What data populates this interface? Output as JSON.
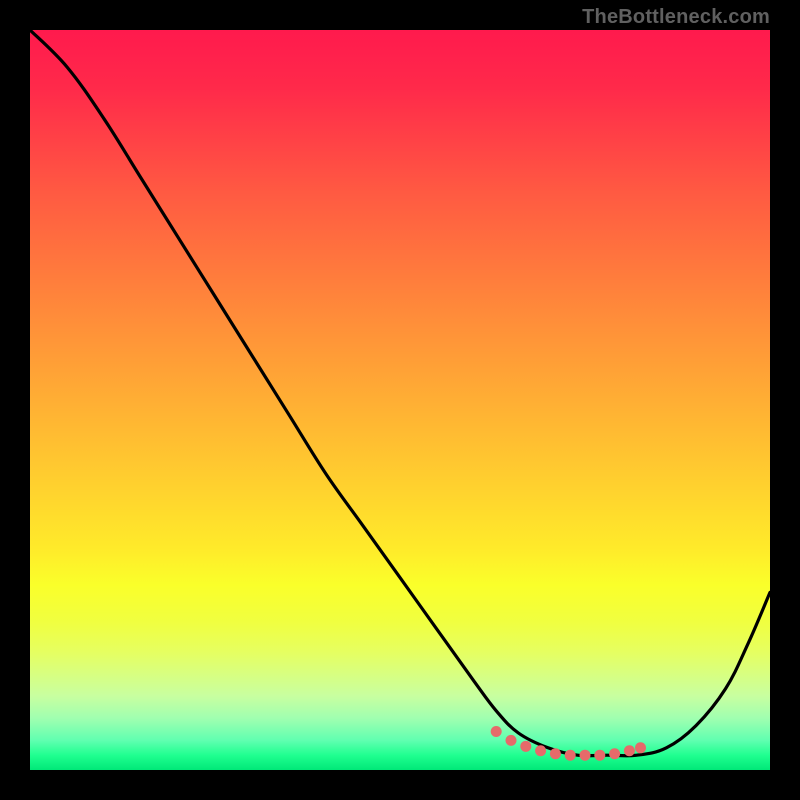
{
  "attribution": "TheBottleneck.com",
  "colors": {
    "background": "#000000",
    "gradient_top": "#ff1a4d",
    "gradient_bottom": "#00e878",
    "curve": "#000000",
    "markers": "#e66a6a"
  },
  "chart_data": {
    "type": "line",
    "title": "",
    "xlabel": "",
    "ylabel": "",
    "xlim": [
      0,
      100
    ],
    "ylim": [
      0,
      100
    ],
    "note": "X as percent across plot width, Y as percent bottleneck (0 = bottom/green/good, 100 = top/red/bad). Values estimated from curve shape.",
    "series": [
      {
        "name": "bottleneck-curve",
        "x": [
          0,
          5,
          10,
          15,
          20,
          25,
          30,
          35,
          40,
          45,
          50,
          55,
          60,
          63,
          66,
          70,
          74,
          78,
          82,
          86,
          90,
          94,
          97,
          100
        ],
        "y": [
          100,
          95,
          88,
          80,
          72,
          64,
          56,
          48,
          40,
          33,
          26,
          19,
          12,
          8,
          5,
          3,
          2,
          2,
          2,
          3,
          6,
          11,
          17,
          24
        ]
      }
    ],
    "markers": {
      "name": "optimal-range",
      "x": [
        63,
        65,
        67,
        69,
        71,
        73,
        75,
        77,
        79,
        81,
        82.5
      ],
      "y": [
        5.2,
        4.0,
        3.2,
        2.6,
        2.2,
        2.0,
        2.0,
        2.0,
        2.2,
        2.6,
        3.0
      ]
    }
  }
}
